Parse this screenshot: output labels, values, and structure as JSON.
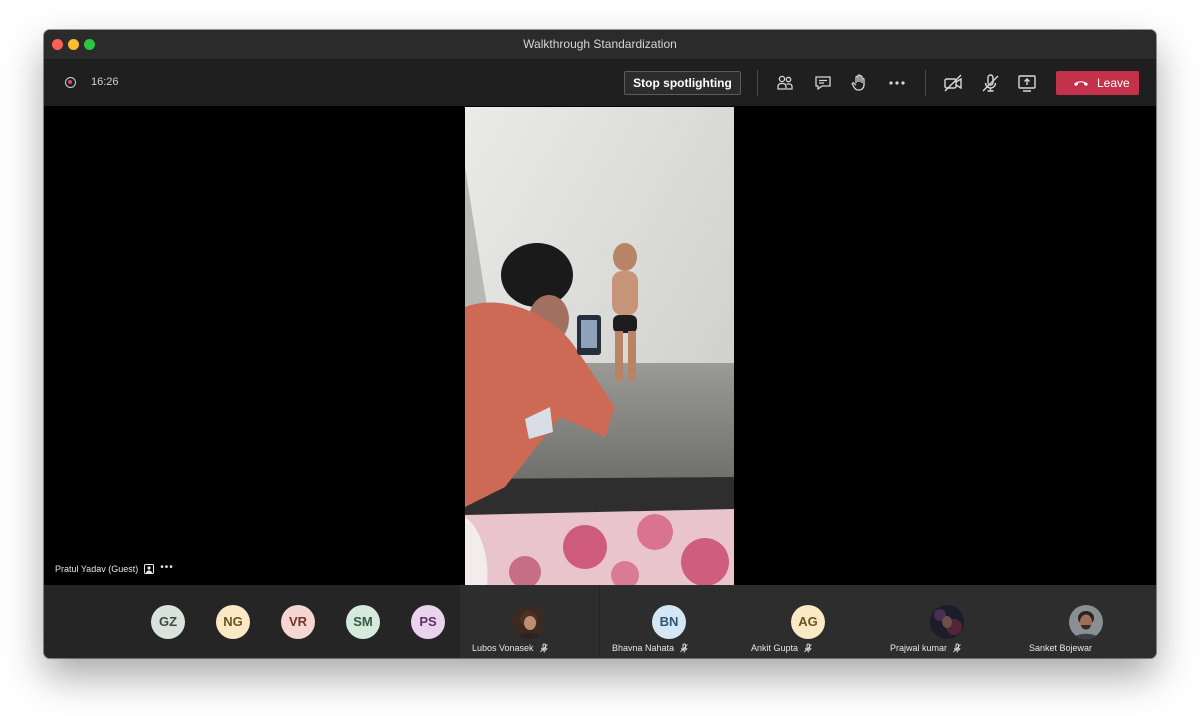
{
  "window": {
    "title": "Walkthrough Standardization"
  },
  "toolbar": {
    "timer": "16:26",
    "stop_spotlight_label": "Stop spotlighting",
    "leave_label": "Leave",
    "icons": [
      "record-icon",
      "participants-icon",
      "chat-icon",
      "raise-hand-icon",
      "more-options-icon",
      "camera-off-icon",
      "mic-off-icon",
      "share-screen-icon",
      "phone-hangup-icon"
    ]
  },
  "spotlight": {
    "name": "Pratul Yadav (Guest)",
    "more": "•••"
  },
  "gallery": {
    "avatars": [
      {
        "initials": "GZ",
        "bg": "#d9e3dc",
        "fg": "#3c4d40"
      },
      {
        "initials": "NG",
        "bg": "#fbe8c4",
        "fg": "#6b5320"
      },
      {
        "initials": "VR",
        "bg": "#f6d6d3",
        "fg": "#73332d"
      },
      {
        "initials": "SM",
        "bg": "#d5eadc",
        "fg": "#35563f"
      },
      {
        "initials": "PS",
        "bg": "#ead3ec",
        "fg": "#5d3362"
      }
    ],
    "tiles": [
      {
        "name": "Lubos Vonasek",
        "type": "photo",
        "muted": true
      },
      {
        "name": "Bhavna Nahata",
        "initials": "BN",
        "bg": "#d4e7f5",
        "fg": "#2d5573",
        "muted": true
      },
      {
        "name": "Ankit Gupta",
        "initials": "AG",
        "bg": "#fbe8c4",
        "fg": "#6b5320",
        "muted": true
      },
      {
        "name": "Prajwal kumar",
        "type": "photo",
        "muted": true
      },
      {
        "name": "Sanket Bojewar",
        "type": "photo",
        "muted": false
      }
    ]
  }
}
